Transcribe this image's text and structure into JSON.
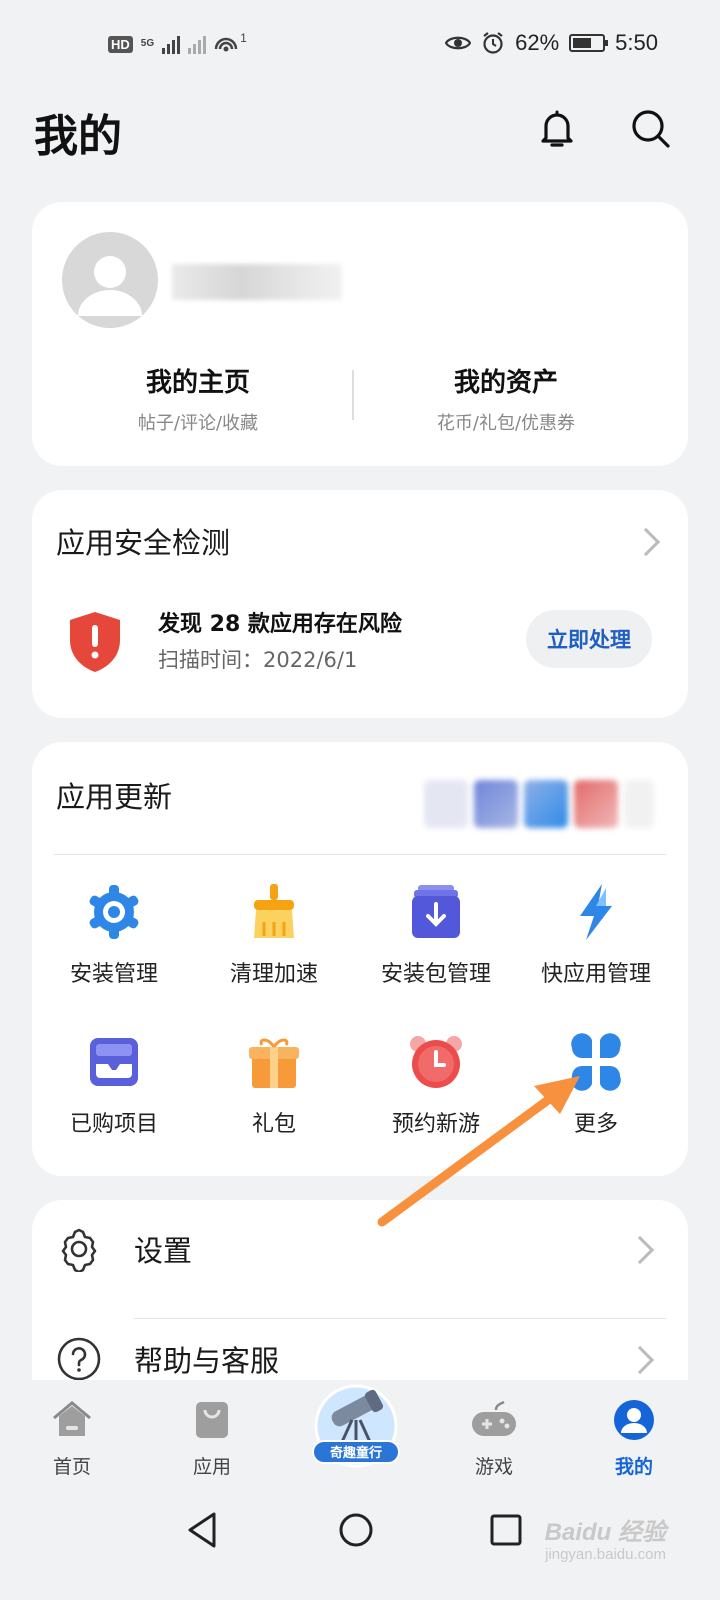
{
  "status_bar": {
    "hd": "HD",
    "net": "5G",
    "hotspot_count": "1",
    "battery": "62%",
    "battery_level": 0.62,
    "time": "5:50"
  },
  "header": {
    "title": "我的",
    "icons": [
      "bell-icon",
      "search-icon"
    ]
  },
  "profile": {
    "home_title": "我的主页",
    "home_sub": "帖子/评论/收藏",
    "assets_title": "我的资产",
    "assets_sub": "花币/礼包/优惠券"
  },
  "security": {
    "title": "应用安全检测",
    "risk_text": "发现 28 款应用存在风险",
    "scan_time": "扫描时间：2022/6/1",
    "action": "立即处理"
  },
  "updates": {
    "title": "应用更新",
    "items": [
      {
        "label": "安装管理",
        "icon": "gear-icon"
      },
      {
        "label": "清理加速",
        "icon": "broom-icon"
      },
      {
        "label": "安装包管理",
        "icon": "package-download-icon"
      },
      {
        "label": "快应用管理",
        "icon": "lightning-icon"
      },
      {
        "label": "已购项目",
        "icon": "purchased-tray-icon"
      },
      {
        "label": "礼包",
        "icon": "gift-icon"
      },
      {
        "label": "预约新游",
        "icon": "alarm-clock-icon"
      },
      {
        "label": "更多",
        "icon": "four-petal-more-icon"
      }
    ]
  },
  "settings_list": [
    {
      "label": "设置",
      "icon": "settings-gear-icon"
    },
    {
      "label": "帮助与客服",
      "icon": "help-icon"
    }
  ],
  "bottom_nav": {
    "items": [
      {
        "label": "首页",
        "icon": "home-icon"
      },
      {
        "label": "应用",
        "icon": "bag-icon"
      },
      {
        "label": "游戏",
        "icon": "gamepad-icon"
      },
      {
        "label": "我的",
        "icon": "user-icon",
        "active": true
      }
    ],
    "promo": "奇趣童行"
  },
  "watermark": {
    "brand": "Baidu 经验",
    "url": "jingyan.baidu.com"
  },
  "colors": {
    "accent": "#1565d8",
    "danger": "#e5483a",
    "annotation_arrow": "#f7913d"
  }
}
